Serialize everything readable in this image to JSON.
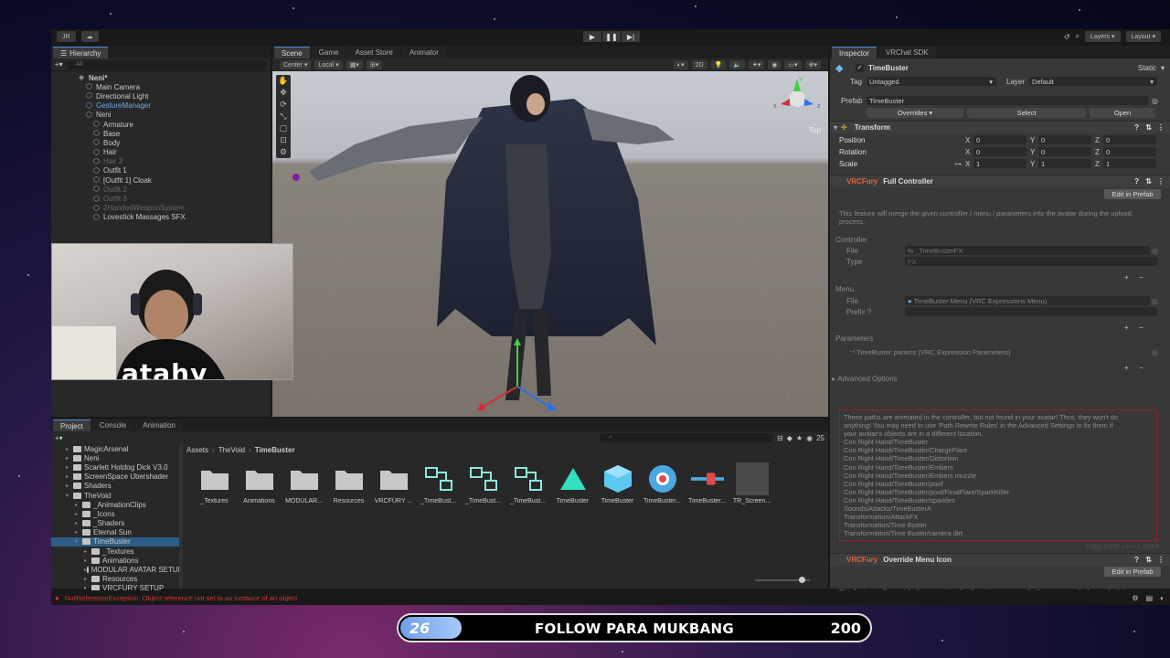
{
  "topbar": {
    "account": "JR",
    "cloud": "☁",
    "layers": "Layers",
    "layout": "Layout"
  },
  "hierarchy": {
    "tab": "Hierarchy",
    "search_placeholder": "All",
    "rows": [
      {
        "label": "Neni*",
        "state": "root"
      },
      {
        "label": "Main Camera",
        "state": "normal"
      },
      {
        "label": "Directional Light",
        "state": "normal"
      },
      {
        "label": "GestureManager",
        "state": "sel"
      },
      {
        "label": "Neni",
        "state": "normal"
      },
      {
        "label": "Armature",
        "state": "normal"
      },
      {
        "label": "Base",
        "state": "normal"
      },
      {
        "label": "Body",
        "state": "normal"
      },
      {
        "label": "Hair",
        "state": "normal"
      },
      {
        "label": "Hair 2",
        "state": "dim"
      },
      {
        "label": "Outfit 1",
        "state": "normal"
      },
      {
        "label": "[Outfit 1] Cloak",
        "state": "normal"
      },
      {
        "label": "Outfit 2",
        "state": "dim"
      },
      {
        "label": "Outfit 3",
        "state": "dim"
      },
      {
        "label": "2HandedWeaponSystem",
        "state": "dim"
      },
      {
        "label": "Lovestick Massages SFX",
        "state": "normal"
      }
    ]
  },
  "webcam": {
    "name": "atahy"
  },
  "scene": {
    "tabs": [
      "Scene",
      "Game",
      "Asset Store",
      "Animator"
    ],
    "pivot": "Center",
    "space": "Local",
    "mode_2d": "2D",
    "gizmo_label": "Top",
    "axis_x": "x",
    "axis_z": "z",
    "axis_y": "y"
  },
  "inspector": {
    "tabs": [
      "Inspector",
      "VRChat SDK"
    ],
    "object_name": "TimeBuster",
    "static": "Static",
    "tag_label": "Tag",
    "tag": "Untagged",
    "layer_label": "Layer",
    "layer": "Default",
    "prefab_label": "Prefab",
    "prefab": "TimeBuster",
    "overrides": "Overrides",
    "select": "Select",
    "open": "Open",
    "transform": "Transform",
    "position": "Position",
    "rotation": "Rotation",
    "scale": "Scale",
    "x": "X",
    "y": "Y",
    "z": "Z",
    "pos": [
      "0",
      "0",
      "0"
    ],
    "rot": [
      "0",
      "0",
      "0"
    ],
    "scl": [
      "1",
      "1",
      "1"
    ],
    "vrcfury": "VRCFury",
    "full_controller": "Full Controller",
    "edit_in_prefab": "Edit in Prefab",
    "fc_desc": "This feature will merge the given controller / menu / parameters into the avatar during the upload process.",
    "controller": "Controller",
    "file": "File",
    "type": "Type",
    "controller_file": "_TimeBusterFX",
    "controller_type": "FX",
    "menu": "Menu",
    "menu_file": "TimeBuster Menu (VRC Expressions Menu)",
    "prefix": "Prefix",
    "parameters": "Parameters",
    "params_file": "TimeBuster params (VRC Expression Parameters)",
    "advanced": "Advanced Options",
    "warning_lines": [
      "These paths are animated in the controller, but not found in your avatar! Thus, they won't do",
      "anything! You may need to use 'Path Rewrite Rules' in the Advanced Settings to fix them if",
      "your avatar's objects are in a different location.",
      "Con Right Hand/TimeBuster",
      "Con Right Hand/TimeBuster/ChargeFlare",
      "Con Right Hand/TimeBuster/Distortion",
      "Con Right Hand/TimeBuster/Embers",
      "Con Right Hand/TimeBuster/Embers muzzle",
      "Con Right Hand/TimeBuster/poof",
      "Con Right Hand/TimeBuster/poof/FinalFlare/SparkKiller",
      "Con Right Hand/TimeBuster/sparkles",
      "Sounds/Attacks/TimeBusterA",
      "Transformation/AttackFX",
      "Transformation/Time Buster",
      "Transformation/Time Buster/camera dirt"
    ],
    "version": "0.2022.3.22f1 1.6.0 / 1.1258.0",
    "override_menu_icon": "Override Menu Icon",
    "omi_desc": "This feature will override the menu icon for the given menu path. You can use slashes to look in subfolders."
  },
  "project": {
    "tabs": [
      "Project",
      "Console",
      "Animation"
    ],
    "count": "25",
    "tree": [
      {
        "label": "MagicArsenal",
        "indent": 1,
        "sel": false
      },
      {
        "label": "Neni",
        "indent": 1,
        "sel": false
      },
      {
        "label": "Scarlett Hotdog Dick V3.0",
        "indent": 1,
        "sel": false
      },
      {
        "label": "ScreenSpace Ubershader",
        "indent": 1,
        "sel": false
      },
      {
        "label": "Shaders",
        "indent": 1,
        "sel": false
      },
      {
        "label": "TheVoid",
        "indent": 1,
        "sel": false
      },
      {
        "label": "_AnimationClips",
        "indent": 2,
        "sel": false
      },
      {
        "label": "_Icons",
        "indent": 2,
        "sel": false
      },
      {
        "label": "_Shaders",
        "indent": 2,
        "sel": false
      },
      {
        "label": "Eternal Sun",
        "indent": 2,
        "sel": false
      },
      {
        "label": "TimeBuster",
        "indent": 2,
        "sel": true
      },
      {
        "label": "_Textures",
        "indent": 3,
        "sel": false
      },
      {
        "label": "Animations",
        "indent": 3,
        "sel": false
      },
      {
        "label": "MODULAR AVATAR SETUP",
        "indent": 3,
        "sel": false
      },
      {
        "label": "Resources",
        "indent": 3,
        "sel": false
      },
      {
        "label": "VRCFURY SETUP",
        "indent": 3,
        "sel": false
      }
    ],
    "breadcrumb": [
      "Assets",
      "TheVoid",
      "TimeBuster"
    ],
    "assets": [
      {
        "label": "_Textures",
        "icon": "folder"
      },
      {
        "label": "Animations",
        "icon": "folder"
      },
      {
        "label": "MODULAR...",
        "icon": "folder"
      },
      {
        "label": "Resources",
        "icon": "folder"
      },
      {
        "label": "VRCFURY ...",
        "icon": "folder"
      },
      {
        "label": "_TimeBust...",
        "icon": "anim-controller"
      },
      {
        "label": "_TimeBust...",
        "icon": "anim-controller"
      },
      {
        "label": "_TimeBust...",
        "icon": "anim-controller"
      },
      {
        "label": "TimeBuster",
        "icon": "material"
      },
      {
        "label": "TimeBuster",
        "icon": "prefab"
      },
      {
        "label": "TimeBuster...",
        "icon": "menu-asset"
      },
      {
        "label": "TimeBuster...",
        "icon": "params-asset"
      },
      {
        "label": "TR_Screen...",
        "icon": "texture"
      }
    ]
  },
  "status": {
    "error": "NullReferenceException: Object reference not set to an instance of an object"
  },
  "follow": {
    "current": "26",
    "text": "FOLLOW PARA MUKBANG",
    "goal": "200",
    "progress": 0.13
  },
  "colors": {
    "accent": "#4a8ad8",
    "vrcfury": "#e06040",
    "error": "#d03838",
    "selected_row": "#2c5d87"
  }
}
